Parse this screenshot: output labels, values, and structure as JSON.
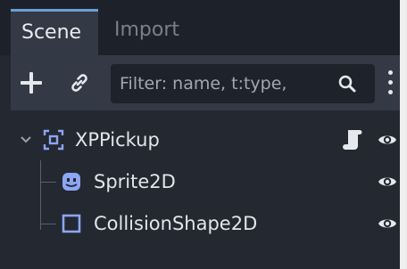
{
  "tabs": [
    {
      "label": "Scene",
      "active": true
    },
    {
      "label": "Import",
      "active": false
    }
  ],
  "toolbar": {
    "add_icon": "plus-icon",
    "link_icon": "link-icon",
    "filter_placeholder": "Filter: name, t:type,",
    "search_icon": "search-icon",
    "menu_icon": "kebab-menu-icon"
  },
  "tree": {
    "nodes": [
      {
        "label": "XPPickup",
        "icon": "node2d-icon",
        "has_script": true,
        "visible": true,
        "expanded": true
      },
      {
        "label": "Sprite2D",
        "icon": "sprite2d-icon",
        "visible": true
      },
      {
        "label": "CollisionShape2D",
        "icon": "collisionshape2d-icon",
        "visible": true
      }
    ]
  },
  "colors": {
    "accent": "#6a9fd8",
    "node2d_icon": "#8da5f3",
    "panel_bg": "#232831",
    "toolbar_bg": "#333a46"
  }
}
